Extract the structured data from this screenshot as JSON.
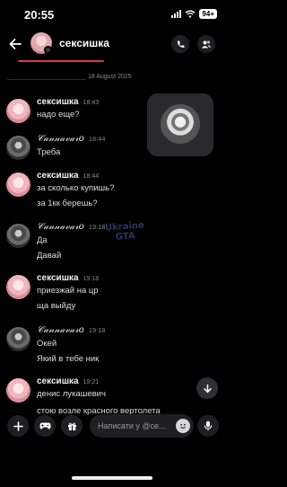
{
  "status": {
    "time": "20:55",
    "battery": "94+"
  },
  "header": {
    "title": "сексишка",
    "chevron": "›"
  },
  "date_separator": "18 August 2025",
  "watermark": {
    "line1": "Ukraine",
    "line2": "GTA"
  },
  "messages": [
    {
      "author": "сексишка",
      "time": "18:43",
      "lines": [
        "надо еще?"
      ],
      "avatar": "girl"
    },
    {
      "author": "𝒞𝒶𝓃𝓃𝒶𝓋𝒶𝓇𝑜",
      "time": "18:44",
      "lines": [
        "Треба"
      ],
      "avatar": "guy"
    },
    {
      "author": "сексишка",
      "time": "18:44",
      "lines": [
        "за сколько купишь?",
        "за 1кк берешь?"
      ],
      "avatar": "girl"
    },
    {
      "author": "𝒞𝒶𝓃𝓃𝒶𝓋𝒶𝓇𝑜",
      "time": "19:18",
      "lines": [
        "Да",
        "Давай"
      ],
      "avatar": "guy"
    },
    {
      "author": "сексишка",
      "time": "19:18",
      "lines": [
        "приезжай на цр",
        "ща выйду"
      ],
      "avatar": "girl"
    },
    {
      "author": "𝒞𝒶𝓃𝓃𝒶𝓋𝒶𝓇𝑜",
      "time": "19:18",
      "lines": [
        "Окей",
        "Який в тебе ник"
      ],
      "avatar": "guy"
    },
    {
      "author": "сексишка",
      "time": "19:21",
      "lines": [
        "денис лукашевич",
        "стою возле красного вертолета"
      ],
      "avatar": "girl"
    }
  ],
  "input": {
    "placeholder": "Написати у @се..."
  },
  "icons": {
    "back": "arrow-left-icon",
    "call": "phone-icon",
    "members": "users-icon",
    "scroll": "arrow-down-icon",
    "plus": "plus-icon",
    "game": "gamepad-icon",
    "gift": "gift-icon",
    "emoji": "smiley-icon",
    "mic": "microphone-icon"
  },
  "colors": {
    "accent_red": "#d93a43",
    "background": "#000000",
    "surface": "#1e1f22"
  }
}
